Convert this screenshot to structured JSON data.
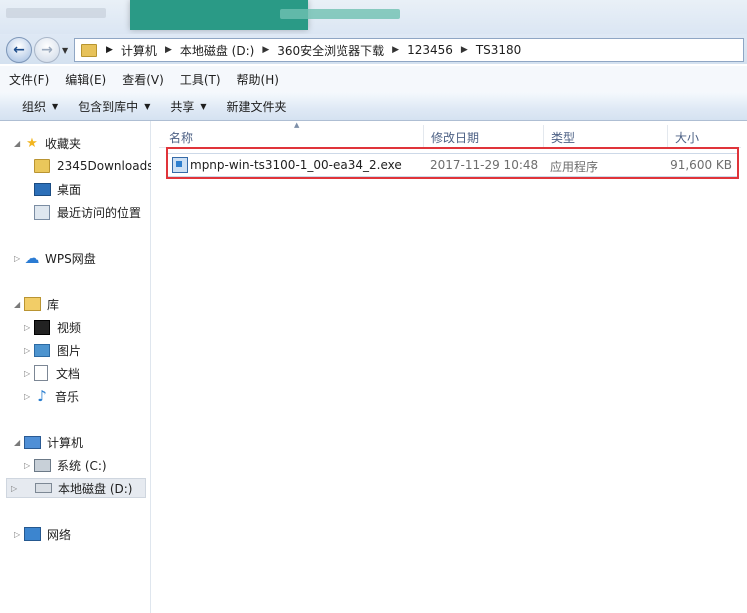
{
  "breadcrumbs": [
    "计算机",
    "本地磁盘 (D:)",
    "360安全浏览器下载",
    "123456",
    "TS3180"
  ],
  "menu": [
    "文件(F)",
    "编辑(E)",
    "查看(V)",
    "工具(T)",
    "帮助(H)"
  ],
  "toolbar": [
    {
      "label": "组织",
      "has_dropdown": true
    },
    {
      "label": "包含到库中",
      "has_dropdown": true
    },
    {
      "label": "共享",
      "has_dropdown": true
    },
    {
      "label": "新建文件夹",
      "has_dropdown": false
    }
  ],
  "nav": {
    "favorites": {
      "label": "收藏夹",
      "items": [
        "2345Downloads",
        "桌面",
        "最近访问的位置"
      ]
    },
    "wps": "WPS网盘",
    "libraries": {
      "label": "库",
      "items": [
        "视频",
        "图片",
        "文档",
        "音乐"
      ]
    },
    "computer": {
      "label": "计算机",
      "items": [
        "系统 (C:)",
        "本地磁盘 (D:)"
      ]
    },
    "network": "网络"
  },
  "columns": {
    "name": "名称",
    "date": "修改日期",
    "type": "类型",
    "size": "大小"
  },
  "files": [
    {
      "name": "mpnp-win-ts3100-1_00-ea34_2.exe",
      "date": "2017-11-29 10:48",
      "type": "应用程序",
      "size": "91,600 KB"
    }
  ],
  "colors": {
    "highlight_border": "#e0343a",
    "accent": "#2f7fce"
  }
}
